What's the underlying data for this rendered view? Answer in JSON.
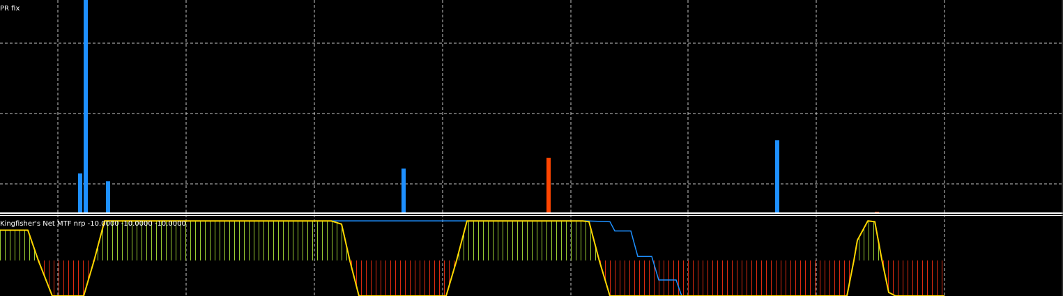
{
  "colors": {
    "background": "#000000",
    "grid": "#c8c8c8",
    "separator": "#ffffff",
    "bar_blue": "#1e90ff",
    "bar_red": "#ff4500",
    "fisher_line": "#ffd700",
    "signal_line": "#1e90ff",
    "hist_up": "#9acd32",
    "hist_down": "#dc2a10"
  },
  "chart_data": [
    {
      "type": "bar",
      "title": "PR fix",
      "xlabel": "",
      "ylabel": "",
      "x_range": [
        0,
        1525
      ],
      "ylim": [
        0,
        3
      ],
      "grid": true,
      "bars": [
        {
          "x": 115,
          "value": 0.55,
          "color": "blue"
        },
        {
          "x": 123,
          "value": 3.0,
          "color": "blue"
        },
        {
          "x": 155,
          "value": 0.44,
          "color": "blue"
        },
        {
          "x": 579,
          "value": 0.62,
          "color": "blue"
        },
        {
          "x": 787,
          "value": 0.77,
          "color": "red"
        },
        {
          "x": 1115,
          "value": 1.02,
          "color": "blue"
        },
        {
          "x": 1258,
          "value": 0.01,
          "color": "red"
        }
      ]
    },
    {
      "type": "line",
      "title": "Kingfisher's Net MTF nrp -10.0000 -10.0000 -10.0000",
      "xlabel": "",
      "ylabel": "",
      "x_range": [
        0,
        1525
      ],
      "ylim": [
        -1.0,
        1.0
      ],
      "zero_line": 0,
      "grid": true,
      "series": [
        {
          "role": "fisher",
          "x": [
            0,
            40,
            75,
            95,
            120,
            135,
            150,
            475,
            490,
            515,
            560,
            640,
            655,
            670,
            835,
            845,
            875,
            900,
            1000,
            1215,
            1230,
            1245,
            1255,
            1275,
            1285,
            1355
          ],
          "y": [
            0.75,
            0.75,
            -1.0,
            -1.0,
            -1.0,
            0.0,
            0.98,
            0.98,
            0.9,
            -1.0,
            -1.0,
            -1.0,
            0.0,
            0.98,
            0.98,
            0.96,
            -1.0,
            -1.0,
            -1.0,
            -1.0,
            0.5,
            0.98,
            0.96,
            -0.9,
            -1.0,
            -1.0
          ]
        },
        {
          "role": "signal",
          "x": [
            475,
            840,
            875,
            882,
            905,
            915,
            935,
            945,
            970,
            978
          ],
          "y": [
            0.98,
            0.98,
            0.96,
            0.73,
            0.73,
            0.1,
            0.1,
            -0.55,
            -0.55,
            -1.0
          ]
        },
        {
          "role": "histogram",
          "x_start": 0,
          "x_end": 1355,
          "step": 7,
          "note": "height = fisher value at x; green when positive, red when negative"
        }
      ]
    }
  ]
}
